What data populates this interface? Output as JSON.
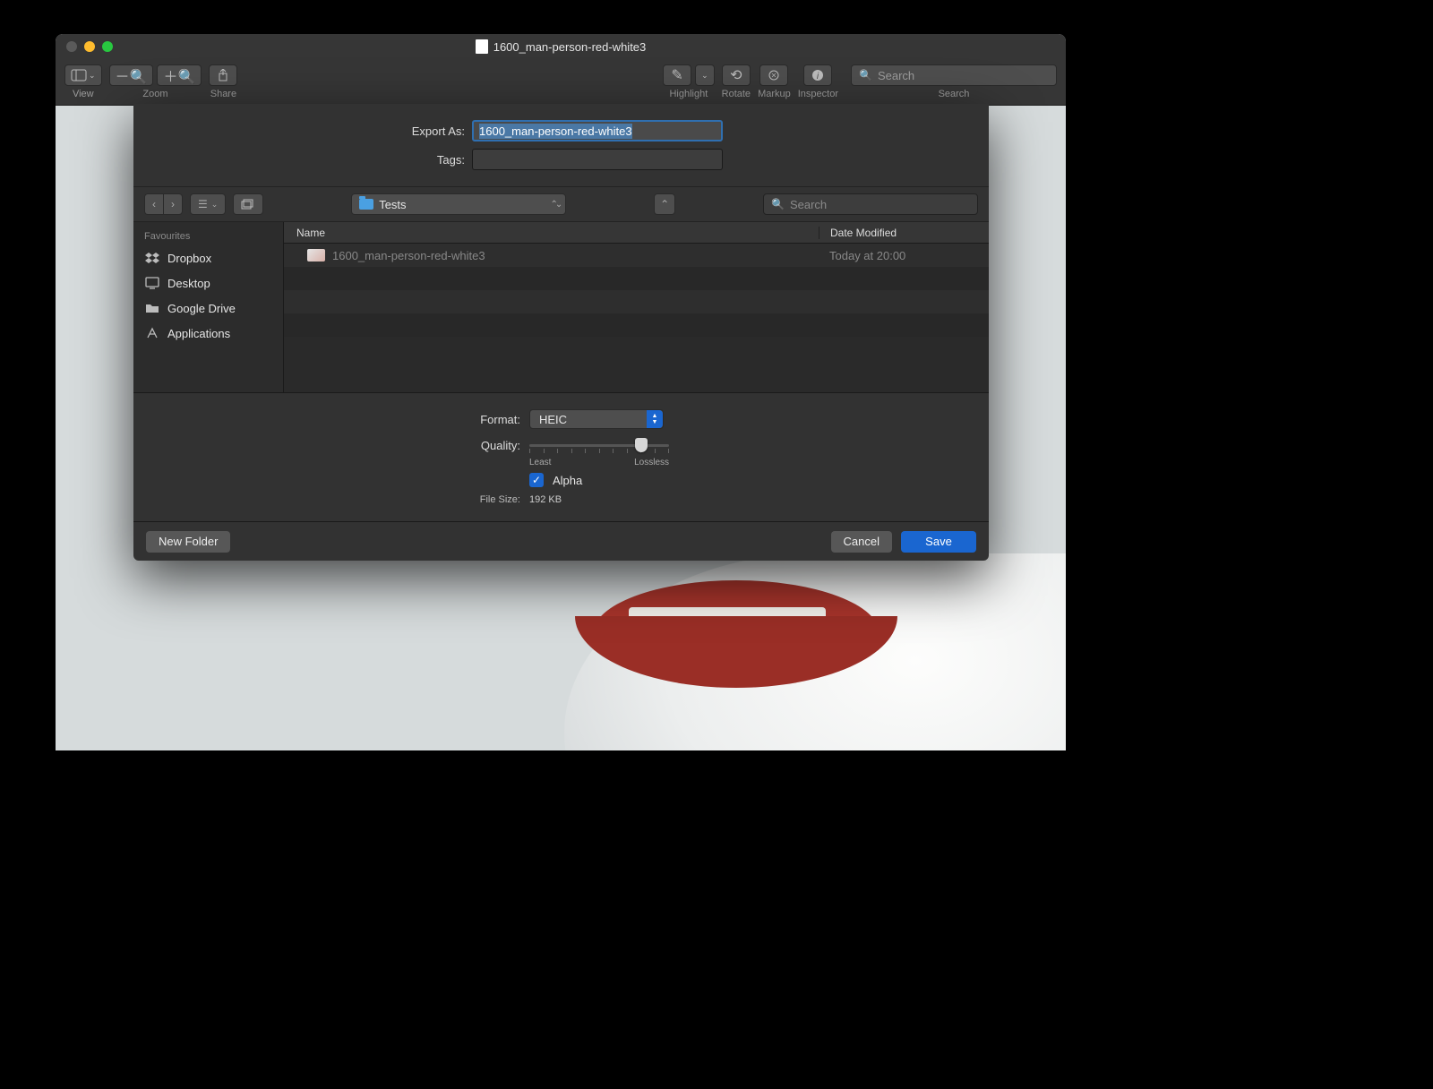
{
  "window": {
    "title": "1600_man-person-red-white3"
  },
  "toolbar": {
    "view": "View",
    "zoom": "Zoom",
    "share": "Share",
    "highlight": "Highlight",
    "rotate": "Rotate",
    "markup": "Markup",
    "inspector": "Inspector",
    "search": "Search",
    "search_placeholder": "Search"
  },
  "export": {
    "export_as_label": "Export As:",
    "filename": "1600_man-person-red-white3",
    "tags_label": "Tags:",
    "tags_value": ""
  },
  "nav": {
    "location": "Tests",
    "search_placeholder": "Search"
  },
  "sidebar": {
    "section": "Favourites",
    "items": [
      {
        "label": "Dropbox"
      },
      {
        "label": "Desktop"
      },
      {
        "label": "Google Drive"
      },
      {
        "label": "Applications"
      }
    ]
  },
  "list": {
    "col_name": "Name",
    "col_date": "Date Modified",
    "rows": [
      {
        "name": "1600_man-person-red-white3",
        "date": "Today at 20:00"
      }
    ]
  },
  "options": {
    "format_label": "Format:",
    "format_value": "HEIC",
    "quality_label": "Quality:",
    "quality_least": "Least",
    "quality_lossless": "Lossless",
    "alpha_label": "Alpha",
    "alpha_checked": true,
    "filesize_label": "File Size:",
    "filesize_value": "192 KB"
  },
  "footer": {
    "new_folder": "New Folder",
    "cancel": "Cancel",
    "save": "Save"
  }
}
